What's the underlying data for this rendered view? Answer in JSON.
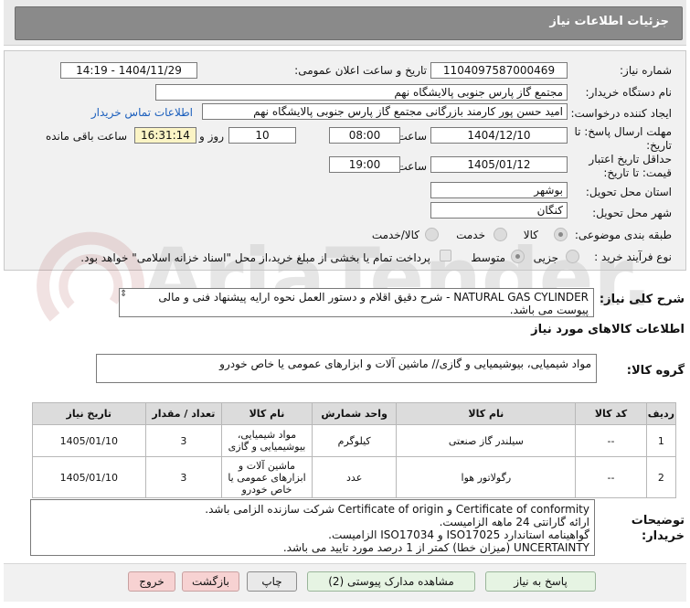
{
  "header": {
    "title": "جزئیات اطلاعات نیاز"
  },
  "info": {
    "need_number_label": "شماره نیاز:",
    "need_number": "1104097587000469",
    "announce_label": "تاریخ و ساعت اعلان عمومی:",
    "announce_value": "1404/11/29 - 14:19",
    "buyer_org_label": "نام دستگاه خریدار:",
    "buyer_org": "مجتمع گاز پارس جنوبی  پالایشگاه نهم",
    "requester_label": "ایجاد کننده درخواست:",
    "requester": "امید حسن پور کارمند بازرگانی مجتمع گاز پارس جنوبی  پالایشگاه نهم",
    "contact_link": "اطلاعات تماس خریدار",
    "deadline_label": "مهلت ارسال پاسخ: تا تاریخ:",
    "deadline_date": "1404/12/10",
    "time_label": "ساعت",
    "deadline_time": "08:00",
    "days_value": "10",
    "days_label": "روز و",
    "remaining_time": "16:31:14",
    "remaining_label": "ساعت باقی مانده",
    "validity_label": "حداقل تاریخ اعتبار قیمت: تا تاریخ:",
    "validity_date": "1405/01/12",
    "validity_time": "19:00",
    "province_label": "استان محل تحویل:",
    "province": "بوشهر",
    "city_label": "شهر محل تحویل:",
    "city": "کنگان",
    "category_label": "طبقه بندی موضوعی:",
    "category_options": [
      "کالا",
      "خدمت",
      "کالا/خدمت"
    ],
    "process_label": "نوع فرآیند خرید :",
    "process_options": [
      "جزیی",
      "متوسط"
    ],
    "payment_note": "پرداخت تمام یا بخشی از مبلغ خرید،از محل \"اسناد خزانه اسلامی\" خواهد بود."
  },
  "summary": {
    "label": "شرح کلی نیاز:",
    "text": "NATURAL GAS CYLINDER - شرح دقیق اقلام و دستور العمل نحوه ارایه پیشنهاد فنی و مالی پیوست می باشد."
  },
  "goods": {
    "section_title": "اطلاعات کالاهای مورد نیاز",
    "group_label": "گروه کالا:",
    "group_value": "مواد شیمیایی، بیوشیمیایی و  گازی//  ماشین آلات و ابزارهای عمومی یا خاص خودرو"
  },
  "table": {
    "headers": [
      "ردیف",
      "کد کالا",
      "نام کالا",
      "واحد شمارش",
      "نام کالا",
      "تعداد / مقدار",
      "تاریخ نیاز"
    ],
    "rows": [
      {
        "index": "1",
        "code": "--",
        "name": "سیلندر گاز صنعتی",
        "unit": "کیلوگرم",
        "group": "مواد شیمیایی، بیوشیمیایی و گازی",
        "qty": "3",
        "date": "1405/01/10"
      },
      {
        "index": "2",
        "code": "--",
        "name": "رگولاتور هوا",
        "unit": "عدد",
        "group": "ماشین آلات و ابزارهای عمومی یا خاص خودرو",
        "qty": "3",
        "date": "1405/01/10"
      }
    ]
  },
  "notes": {
    "label": "توضیحات خریدار:",
    "lines": [
      "Certificate of conformity و Certificate of origin شرکت سازنده الزامی باشد.",
      "ارائه گارانتی 24 ماهه الزامیست.",
      "گواهینامه استاندارد ISO17025  و ISO17034 الزامیست.",
      "UNCERTAINTY (میزان خطا) کمتر از 1 درصد مورد تایید می باشد."
    ]
  },
  "buttons": {
    "reply": "پاسخ به نیاز",
    "attachments": "مشاهده مدارک پیوستی (2)",
    "print": "چاپ",
    "back": "بازگشت",
    "exit": "خروج"
  },
  "watermark": {
    "text": "AriaTender.neT"
  }
}
